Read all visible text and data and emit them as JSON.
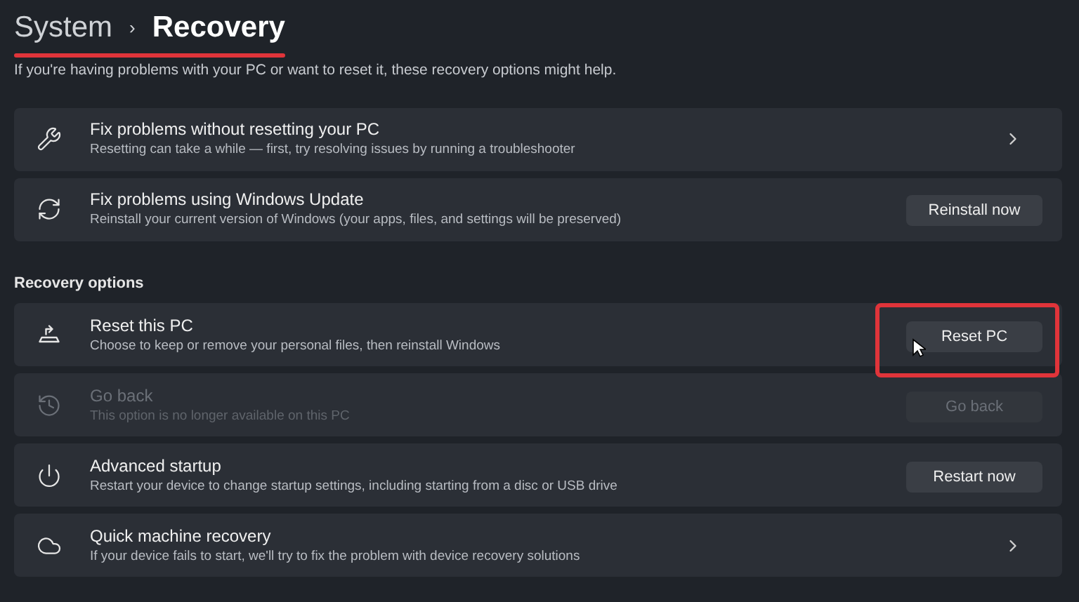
{
  "breadcrumb": {
    "parent": "System",
    "separator": "›",
    "current": "Recovery",
    "underlined": true
  },
  "description": "If you're having problems with your PC or want to reset it, these recovery options might help.",
  "top_items": [
    {
      "title": "Fix problems without resetting your PC",
      "subtitle": "Resetting can take a while — first, try resolving issues by running a troubleshooter",
      "kind": "link",
      "disabled": false
    },
    {
      "title": "Fix problems using Windows Update",
      "subtitle": "Reinstall your current version of Windows (your apps, files, and settings will be preserved)",
      "kind": "button",
      "button": "Reinstall now",
      "disabled": false,
      "highlighted": false
    }
  ],
  "section_title": "Recovery options",
  "items": [
    {
      "title": "Reset this PC",
      "subtitle": "Choose to keep or remove your personal files, then reinstall Windows",
      "kind": "button",
      "button": "Reset PC",
      "disabled": false,
      "highlighted": true
    },
    {
      "title": "Go back",
      "subtitle": "This option is no longer available on this PC",
      "kind": "button",
      "button": "Go back",
      "disabled": true,
      "highlighted": false
    },
    {
      "title": "Advanced startup",
      "subtitle": "Restart your device to change startup settings, including starting from a disc or USB drive",
      "kind": "button",
      "button": "Restart now",
      "disabled": false,
      "highlighted": false
    },
    {
      "title": "Quick machine recovery",
      "subtitle": "If your device fails to start, we'll try to fix the problem with device recovery solutions",
      "kind": "link",
      "disabled": false
    }
  ]
}
